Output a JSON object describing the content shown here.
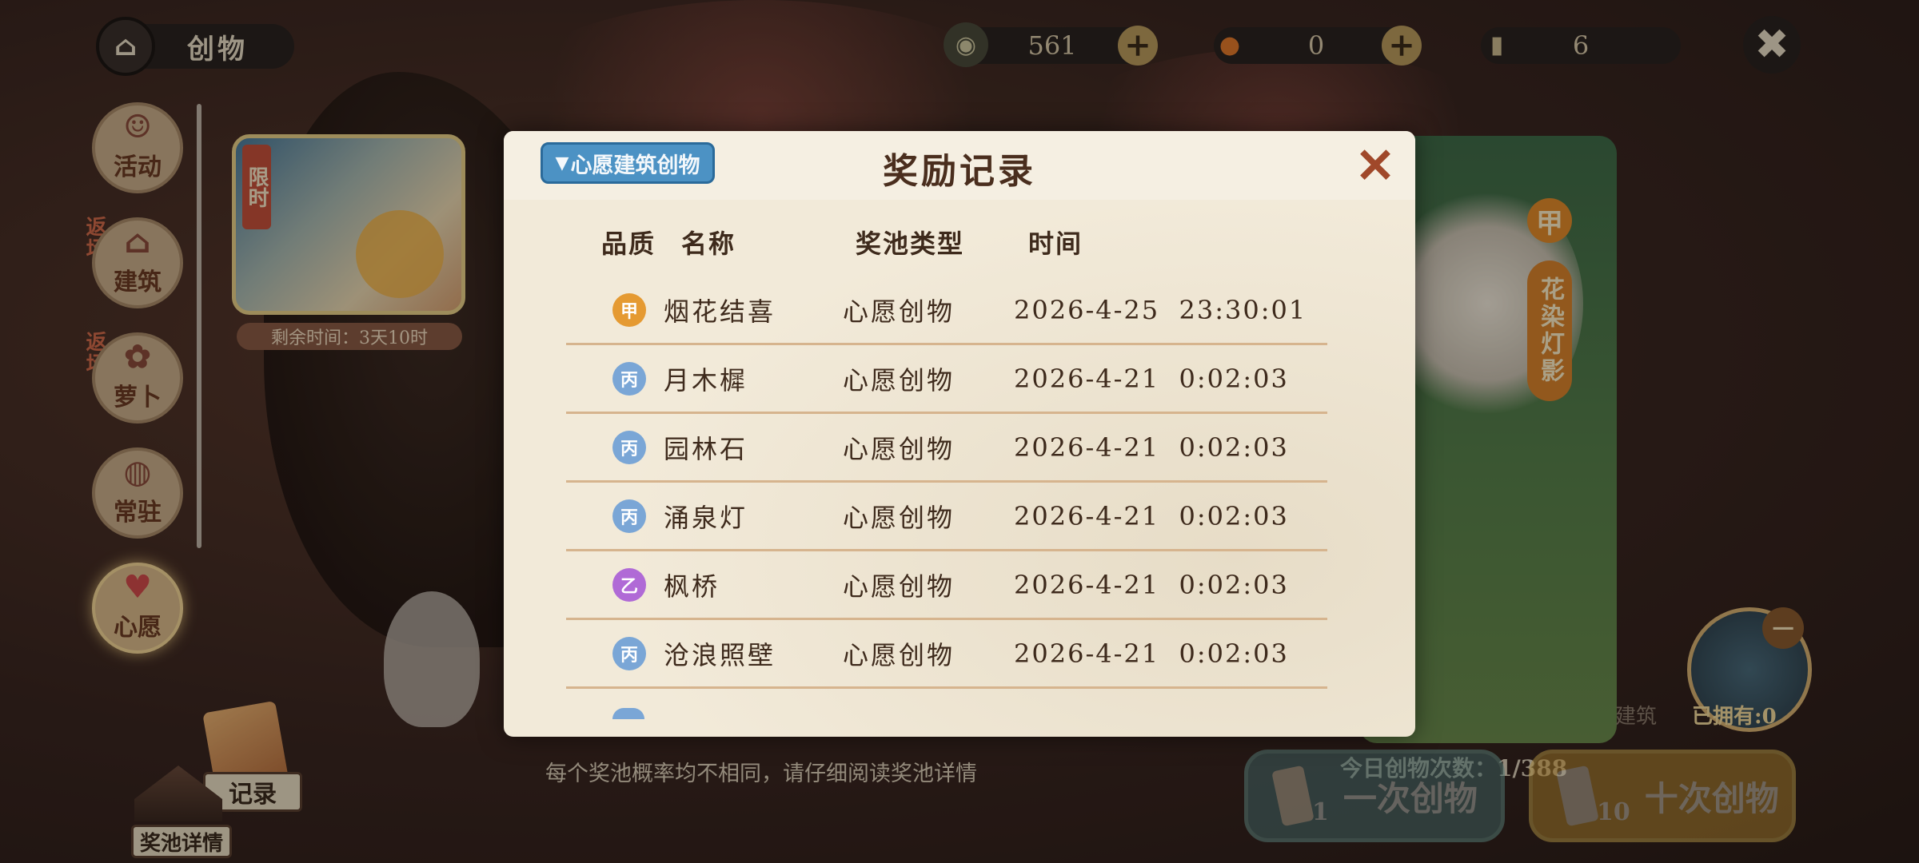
{
  "topbar": {
    "title": "创物",
    "currencies": [
      {
        "icon": "coin-icon",
        "value": "561"
      },
      {
        "icon": "orange-icon",
        "value": "0"
      },
      {
        "icon": "scroll-icon",
        "value": "6"
      }
    ]
  },
  "sidebar": {
    "items": [
      {
        "label": "活动",
        "icon": "lion-dance-icon"
      },
      {
        "label": "建筑",
        "icon": "house-icon",
        "tag": "返场"
      },
      {
        "label": "萝卜",
        "icon": "radish-icon",
        "tag": "返场"
      },
      {
        "label": "常驻",
        "icon": "bun-icon"
      },
      {
        "label": "心愿",
        "icon": "heart-icon"
      }
    ]
  },
  "banner": {
    "limited": "限时",
    "remaining": "剩余时间：3天10时"
  },
  "preview": {
    "grade": "甲",
    "name": "花染灯影",
    "owned": "已拥有:0",
    "partial": "建筑"
  },
  "bottom": {
    "pool_note": "每个奖池概率均不相同，请仔细阅读奖池详情",
    "record_label": "记录",
    "pool_detail_label": "奖池详情",
    "today_count": "今日创物次数：1/388",
    "draw_one": {
      "count": "1",
      "label": "一次创物"
    },
    "draw_ten": {
      "count": "10",
      "label": "十次创物"
    }
  },
  "modal": {
    "title": "奖励记录",
    "dropdown": "心愿建筑创物",
    "columns": {
      "grade": "品质",
      "name": "名称",
      "pool": "奖池类型",
      "time": "时间"
    },
    "rows": [
      {
        "grade": "甲",
        "name": "烟花结喜",
        "pool": "心愿创物",
        "time": "2026-4-25  23:30:01"
      },
      {
        "grade": "丙",
        "name": "月木樨",
        "pool": "心愿创物",
        "time": "2026-4-21  0:02:03"
      },
      {
        "grade": "丙",
        "name": "园林石",
        "pool": "心愿创物",
        "time": "2026-4-21  0:02:03"
      },
      {
        "grade": "丙",
        "name": "涌泉灯",
        "pool": "心愿创物",
        "time": "2026-4-21  0:02:03"
      },
      {
        "grade": "乙",
        "name": "枫桥",
        "pool": "心愿创物",
        "time": "2026-4-21  0:02:03"
      },
      {
        "grade": "丙",
        "name": "沧浪照壁",
        "pool": "心愿创物",
        "time": "2026-4-21  0:02:03"
      }
    ]
  }
}
